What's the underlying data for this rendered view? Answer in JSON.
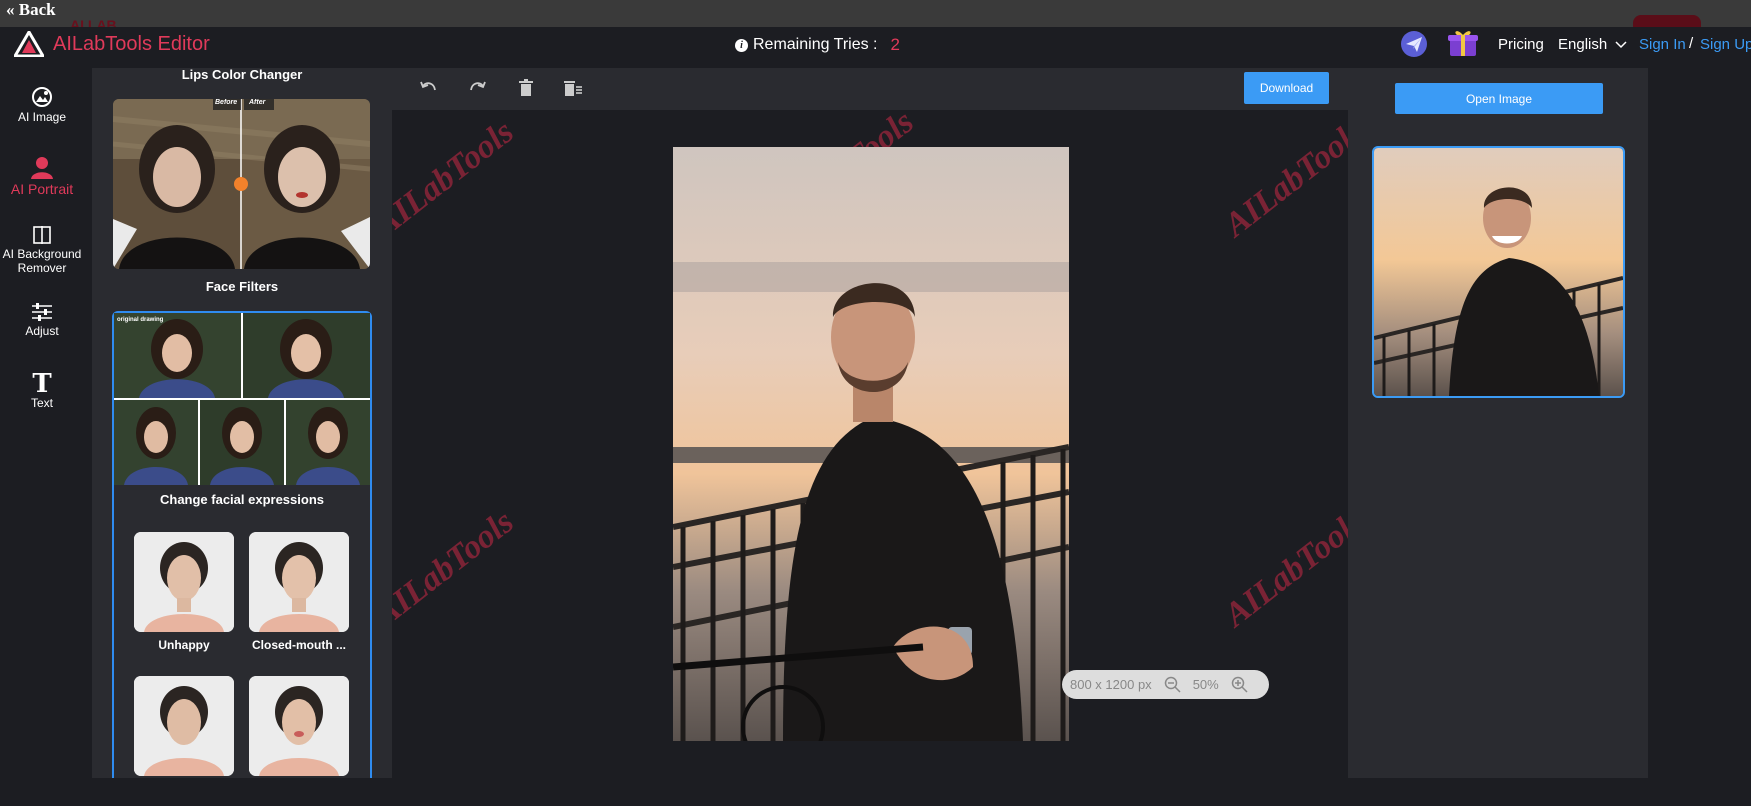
{
  "top": {
    "back_label": "« Back",
    "ghost_logo": "AI LAB"
  },
  "header": {
    "app_title": "AILabTools Editor",
    "tries_label": "Remaining Tries :",
    "tries_count": "2",
    "pricing": "Pricing",
    "language": "English",
    "sign_in": "Sign In",
    "separator": "/",
    "sign_up": "Sign Up"
  },
  "nav": [
    {
      "label": "AI Image",
      "icon": "ai-image-icon"
    },
    {
      "label": "AI Portrait",
      "icon": "portrait-icon",
      "active": true
    },
    {
      "label": "AI Background Remover",
      "icon": "background-remover-icon"
    },
    {
      "label": "Adjust",
      "icon": "sliders-icon"
    },
    {
      "label": "Text",
      "icon": "text-icon"
    }
  ],
  "panel": {
    "lips_title": "Lips Color Changer",
    "lips_before": "Before",
    "lips_after": "After",
    "face_filters_title": "Face Filters",
    "face_badge": "original drawing",
    "face_caption": "Change facial expressions",
    "expressions": [
      {
        "label": "Unhappy"
      },
      {
        "label": "Closed-mouth ..."
      },
      {
        "label": ""
      },
      {
        "label": ""
      }
    ]
  },
  "toolbar": {
    "download": "Download",
    "tools": [
      "undo-icon",
      "redo-icon",
      "trash-icon",
      "clear-all-icon"
    ]
  },
  "canvas": {
    "watermark": "AILabTools",
    "dimensions": "800 x 1200 px",
    "zoom": "50%"
  },
  "right": {
    "open_image": "Open Image"
  },
  "colors": {
    "accent": "#3b9bf5",
    "brand": "#e03a5a",
    "panel": "#2a2b30",
    "bg": "#1c1d22"
  }
}
